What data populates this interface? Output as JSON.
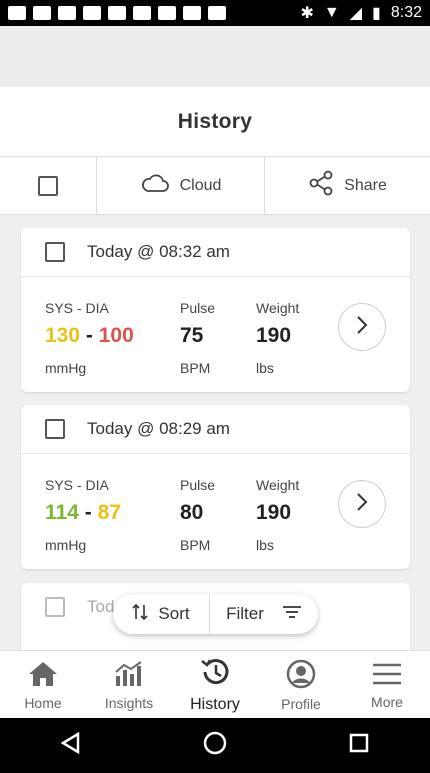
{
  "status_bar": {
    "time": "8:32"
  },
  "header": {
    "title": "History"
  },
  "toolbar": {
    "cloud_label": "Cloud",
    "share_label": "Share"
  },
  "records": [
    {
      "date": "Today @ 08:32 am",
      "sys_dia_label": "SYS - DIA",
      "sys": "130",
      "dash": "-",
      "dia": "100",
      "sys_color": "#e8c21a",
      "dia_color": "#d9534f",
      "bp_unit": "mmHg",
      "pulse_label": "Pulse",
      "pulse": "75",
      "pulse_unit": "BPM",
      "weight_label": "Weight",
      "weight": "190",
      "weight_unit": "lbs"
    },
    {
      "date": "Today @ 08:29 am",
      "sys_dia_label": "SYS - DIA",
      "sys": "114",
      "dash": "-",
      "dia": "87",
      "sys_color": "#7cb82f",
      "dia_color": "#e8c21a",
      "bp_unit": "mmHg",
      "pulse_label": "Pulse",
      "pulse": "80",
      "pulse_unit": "BPM",
      "weight_label": "Weight",
      "weight": "190",
      "weight_unit": "lbs"
    },
    {
      "date_partial": "Tod"
    }
  ],
  "sort_filter": {
    "sort_label": "Sort",
    "filter_label": "Filter"
  },
  "bottom_nav": {
    "items": [
      {
        "label": "Home",
        "icon": "home-icon"
      },
      {
        "label": "Insights",
        "icon": "chart-icon"
      },
      {
        "label": "History",
        "icon": "history-icon",
        "active": true
      },
      {
        "label": "Profile",
        "icon": "profile-icon"
      },
      {
        "label": "More",
        "icon": "menu-icon"
      }
    ]
  }
}
